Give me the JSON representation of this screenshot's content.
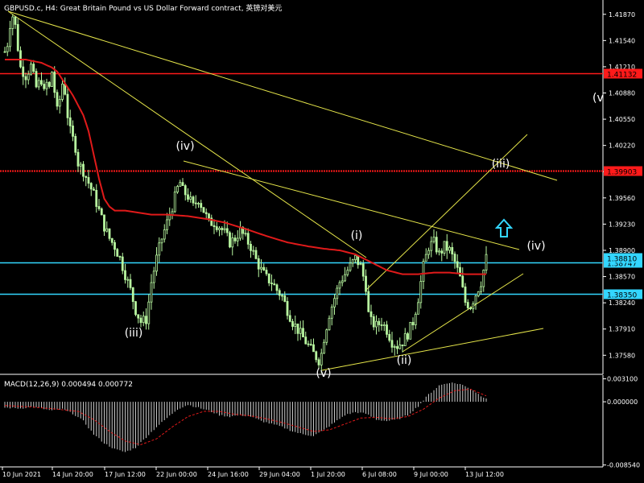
{
  "window": {
    "title": "GBPUSD.c, H4:  Great Britain Pound vs US Dollar Forward contract, 英镑对美元"
  },
  "colors": {
    "background": "#000000",
    "axis": "#ffffff",
    "candle_up": "#ffffff",
    "candle": "#b8f7a0",
    "ma_line": "#e01a1a",
    "trendline": "#e6e64a",
    "hline_red": "#ff1a1a",
    "hline_cyan": "#33d6ff",
    "label_cyan_bg": "#33d6ff",
    "label_red_bg": "#ff1a1a",
    "wave_label": "#ffffff",
    "arrow": "#33d6ff",
    "macd_hist": "#c8c8c8",
    "macd_signal": "#e01a1a"
  },
  "price_axis": {
    "ticks": [
      "1.41870",
      "1.41540",
      "1.41210",
      "1.40880",
      "1.40550",
      "1.40220",
      "1.39890",
      "1.39560",
      "1.39230",
      "1.38900",
      "1.38570",
      "1.38240",
      "1.37910",
      "1.37580"
    ],
    "tick_values": [
      1.4187,
      1.4154,
      1.4121,
      1.4088,
      1.4055,
      1.4022,
      1.3989,
      1.3956,
      1.3923,
      1.389,
      1.3857,
      1.3824,
      1.3791,
      1.3758
    ],
    "ylim": [
      1.3734,
      1.4205
    ]
  },
  "time_axis": {
    "ticks": [
      "10 Jun 2021",
      "14 Jun 20:00",
      "17 Jun 12:00",
      "22 Jun 00:00",
      "24 Jun 16:00",
      "29 Jun 04:00",
      "1 Jul 20:00",
      "6 Jul 08:00",
      "9 Jul 00:00",
      "13 Jul 12:00"
    ]
  },
  "hlines": [
    {
      "value": 1.41132,
      "label": "1.41132",
      "color": "hline_red",
      "style": "solid"
    },
    {
      "value": 1.39903,
      "label": "1.39903",
      "color": "hline_red",
      "style": "dotted"
    },
    {
      "value": 1.38747,
      "label": "1.38747",
      "color": "hline_cyan",
      "style": "solid"
    },
    {
      "value": 1.3835,
      "label": "1.38350",
      "color": "hline_cyan",
      "style": "solid"
    },
    {
      "value": 1.3881,
      "label": "1.38810",
      "color": "hline_cyan",
      "style": "none"
    }
  ],
  "wave_labels": [
    {
      "text": "(iv)",
      "label_id": "wave-iv-left"
    },
    {
      "text": "(iii)",
      "label_id": "wave-iii-left"
    },
    {
      "text": "(i)",
      "label_id": "wave-i"
    },
    {
      "text": "(v)",
      "label_id": "wave-v-bottom"
    },
    {
      "text": "(ii)",
      "label_id": "wave-ii"
    },
    {
      "text": "(iii)",
      "label_id": "wave-iii-right"
    },
    {
      "text": "(iv)",
      "label_id": "wave-iv-right"
    },
    {
      "text": "(v",
      "label_id": "wave-v-right"
    }
  ],
  "macd": {
    "label": "MACD(12,26,9) 0.000494 0.000772",
    "ticks": [
      "0.003100",
      "0.000000",
      "-0.008540"
    ],
    "tick_values": [
      0.0031,
      0.0,
      -0.00854
    ],
    "ylim": [
      -0.0088,
      0.0036
    ]
  },
  "chart_data": {
    "type": "candlestick",
    "title": "GBPUSD.c, H4:  Great Britain Pound vs US Dollar Forward contract, 英镑对美元",
    "xlabel": "",
    "ylabel": "",
    "x_range": [
      "10 Jun 2021",
      "14 Jul 2021"
    ],
    "ylim": [
      1.3734,
      1.4205
    ],
    "price_path": [
      [
        0,
        1.414
      ],
      [
        1,
        1.415
      ],
      [
        2,
        1.4175
      ],
      [
        3,
        1.4185
      ],
      [
        4,
        1.4172
      ],
      [
        5,
        1.4145
      ],
      [
        6,
        1.412
      ],
      [
        8,
        1.411
      ],
      [
        10,
        1.4122
      ],
      [
        12,
        1.4095
      ],
      [
        14,
        1.4105
      ],
      [
        15,
        1.4088
      ],
      [
        16,
        1.41
      ],
      [
        17,
        1.4094
      ],
      [
        18,
        1.4115
      ],
      [
        19,
        1.409
      ],
      [
        20,
        1.4065
      ],
      [
        21,
        1.408
      ],
      [
        22,
        1.41
      ],
      [
        23,
        1.409
      ],
      [
        24,
        1.406
      ],
      [
        25,
        1.404
      ],
      [
        26,
        1.403
      ],
      [
        27,
        1.402
      ],
      [
        28,
        1.4
      ],
      [
        30,
        1.399
      ],
      [
        32,
        1.3975
      ],
      [
        34,
        1.396
      ],
      [
        36,
        1.394
      ],
      [
        38,
        1.392
      ],
      [
        40,
        1.3905
      ],
      [
        42,
        1.3895
      ],
      [
        44,
        1.388
      ],
      [
        46,
        1.386
      ],
      [
        48,
        1.384
      ],
      [
        50,
        1.3815
      ],
      [
        52,
        1.38
      ],
      [
        54,
        1.3803
      ],
      [
        55,
        1.3825
      ],
      [
        56,
        1.385
      ],
      [
        58,
        1.388
      ],
      [
        60,
        1.3905
      ],
      [
        62,
        1.3925
      ],
      [
        64,
        1.3945
      ],
      [
        66,
        1.3968
      ],
      [
        67,
        1.3975
      ],
      [
        68,
        1.3965
      ],
      [
        70,
        1.3958
      ],
      [
        72,
        1.3945
      ],
      [
        74,
        1.3955
      ],
      [
        76,
        1.394
      ],
      [
        78,
        1.3925
      ],
      [
        80,
        1.3925
      ],
      [
        82,
        1.392
      ],
      [
        84,
        1.3912
      ],
      [
        86,
        1.39
      ],
      [
        88,
        1.3905
      ],
      [
        90,
        1.3915
      ],
      [
        92,
        1.3905
      ],
      [
        94,
        1.3895
      ],
      [
        96,
        1.3878
      ],
      [
        98,
        1.3865
      ],
      [
        100,
        1.3855
      ],
      [
        102,
        1.385
      ],
      [
        104,
        1.384
      ],
      [
        106,
        1.3832
      ],
      [
        108,
        1.3815
      ],
      [
        110,
        1.38
      ],
      [
        112,
        1.379
      ],
      [
        114,
        1.378
      ],
      [
        116,
        1.377
      ],
      [
        118,
        1.376
      ],
      [
        120,
        1.3752
      ],
      [
        121,
        1.376
      ],
      [
        122,
        1.378
      ],
      [
        124,
        1.381
      ],
      [
        126,
        1.383
      ],
      [
        128,
        1.385
      ],
      [
        130,
        1.386
      ],
      [
        132,
        1.387
      ],
      [
        134,
        1.388
      ],
      [
        136,
        1.387
      ],
      [
        138,
        1.3845
      ],
      [
        139,
        1.381
      ],
      [
        140,
        1.38
      ],
      [
        142,
        1.3795
      ],
      [
        144,
        1.38
      ],
      [
        146,
        1.379
      ],
      [
        148,
        1.3775
      ],
      [
        150,
        1.377
      ],
      [
        152,
        1.3775
      ],
      [
        154,
        1.3785
      ],
      [
        156,
        1.38
      ],
      [
        158,
        1.383
      ],
      [
        160,
        1.387
      ],
      [
        162,
        1.3895
      ],
      [
        164,
        1.39
      ],
      [
        166,
        1.3885
      ],
      [
        168,
        1.3895
      ],
      [
        170,
        1.389
      ],
      [
        172,
        1.3875
      ],
      [
        174,
        1.3855
      ],
      [
        176,
        1.3825
      ],
      [
        178,
        1.382
      ],
      [
        180,
        1.3835
      ],
      [
        182,
        1.385
      ],
      [
        184,
        1.388
      ]
    ],
    "ma_path": [
      [
        0,
        1.413
      ],
      [
        8,
        1.413
      ],
      [
        14,
        1.4126
      ],
      [
        18,
        1.412
      ],
      [
        20,
        1.4115
      ],
      [
        22,
        1.4105
      ],
      [
        26,
        1.4085
      ],
      [
        30,
        1.406
      ],
      [
        32,
        1.404
      ],
      [
        34,
        1.401
      ],
      [
        36,
        1.398
      ],
      [
        38,
        1.3955
      ],
      [
        40,
        1.3945
      ],
      [
        42,
        1.394
      ],
      [
        46,
        1.394
      ],
      [
        50,
        1.3938
      ],
      [
        56,
        1.3935
      ],
      [
        62,
        1.3935
      ],
      [
        70,
        1.3933
      ],
      [
        78,
        1.3929
      ],
      [
        84,
        1.3925
      ],
      [
        92,
        1.3917
      ],
      [
        100,
        1.3908
      ],
      [
        108,
        1.39
      ],
      [
        116,
        1.3895
      ],
      [
        122,
        1.3892
      ],
      [
        128,
        1.389
      ],
      [
        134,
        1.3885
      ],
      [
        140,
        1.3875
      ],
      [
        146,
        1.3865
      ],
      [
        152,
        1.386
      ],
      [
        158,
        1.386
      ],
      [
        164,
        1.3862
      ],
      [
        170,
        1.3862
      ],
      [
        176,
        1.386
      ],
      [
        184,
        1.386
      ]
    ],
    "macd_hist_path": [
      [
        0,
        -0.0008
      ],
      [
        6,
        -0.0009
      ],
      [
        10,
        -0.0007
      ],
      [
        14,
        -0.0009
      ],
      [
        18,
        -0.0012
      ],
      [
        22,
        -0.001
      ],
      [
        26,
        -0.0016
      ],
      [
        30,
        -0.0026
      ],
      [
        34,
        -0.0044
      ],
      [
        38,
        -0.0056
      ],
      [
        42,
        -0.0064
      ],
      [
        46,
        -0.0068
      ],
      [
        50,
        -0.0062
      ],
      [
        54,
        -0.0048
      ],
      [
        58,
        -0.0034
      ],
      [
        62,
        -0.0022
      ],
      [
        66,
        -0.001
      ],
      [
        70,
        -0.0004
      ],
      [
        74,
        -0.0008
      ],
      [
        78,
        -0.0012
      ],
      [
        82,
        -0.0018
      ],
      [
        86,
        -0.002
      ],
      [
        90,
        -0.0018
      ],
      [
        94,
        -0.002
      ],
      [
        98,
        -0.0026
      ],
      [
        102,
        -0.003
      ],
      [
        106,
        -0.0034
      ],
      [
        110,
        -0.004
      ],
      [
        114,
        -0.0044
      ],
      [
        118,
        -0.0046
      ],
      [
        122,
        -0.0038
      ],
      [
        126,
        -0.0028
      ],
      [
        130,
        -0.0018
      ],
      [
        134,
        -0.0014
      ],
      [
        138,
        -0.0016
      ],
      [
        142,
        -0.0024
      ],
      [
        146,
        -0.0026
      ],
      [
        150,
        -0.0024
      ],
      [
        154,
        -0.0018
      ],
      [
        158,
        -0.0006
      ],
      [
        162,
        0.001
      ],
      [
        166,
        0.0022
      ],
      [
        170,
        0.0026
      ],
      [
        174,
        0.0024
      ],
      [
        178,
        0.0018
      ],
      [
        182,
        0.0008
      ],
      [
        184,
        0.0005
      ]
    ],
    "macd_signal_path": [
      [
        0,
        -0.0005
      ],
      [
        10,
        -0.0007
      ],
      [
        20,
        -0.001
      ],
      [
        28,
        -0.0013
      ],
      [
        34,
        -0.0024
      ],
      [
        40,
        -0.004
      ],
      [
        46,
        -0.0053
      ],
      [
        52,
        -0.0058
      ],
      [
        58,
        -0.005
      ],
      [
        64,
        -0.0034
      ],
      [
        70,
        -0.002
      ],
      [
        76,
        -0.0013
      ],
      [
        82,
        -0.0013
      ],
      [
        88,
        -0.0017
      ],
      [
        94,
        -0.0019
      ],
      [
        100,
        -0.0023
      ],
      [
        106,
        -0.0028
      ],
      [
        112,
        -0.0034
      ],
      [
        118,
        -0.004
      ],
      [
        124,
        -0.0038
      ],
      [
        130,
        -0.003
      ],
      [
        136,
        -0.0022
      ],
      [
        142,
        -0.0021
      ],
      [
        148,
        -0.0023
      ],
      [
        154,
        -0.002
      ],
      [
        160,
        -0.001
      ],
      [
        166,
        0.0005
      ],
      [
        172,
        0.0015
      ],
      [
        178,
        0.0017
      ],
      [
        184,
        0.0008
      ]
    ]
  }
}
